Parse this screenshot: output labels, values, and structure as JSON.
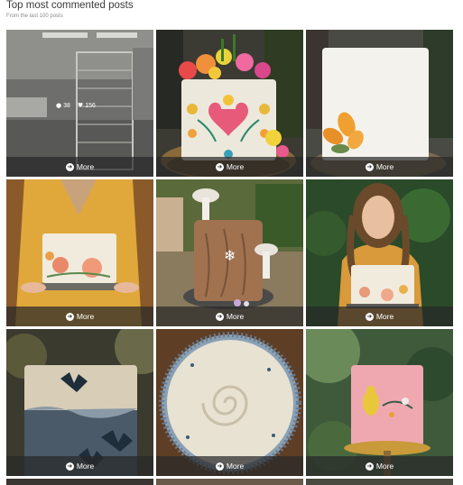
{
  "header": {
    "title": "Top most commented posts",
    "subtitle": "From the last 100 posts"
  },
  "posts": [
    {
      "more_label": "More",
      "comments": "38",
      "likes": "156",
      "comment_icon": "speech-bubble-icon",
      "like_icon": "heart-icon"
    },
    {
      "more_label": "More"
    },
    {
      "more_label": "More"
    },
    {
      "more_label": "More"
    },
    {
      "more_label": "More"
    },
    {
      "more_label": "More"
    },
    {
      "more_label": "More"
    },
    {
      "more_label": "More"
    },
    {
      "more_label": "More"
    }
  ],
  "more_icon": "arrow-circle-icon"
}
